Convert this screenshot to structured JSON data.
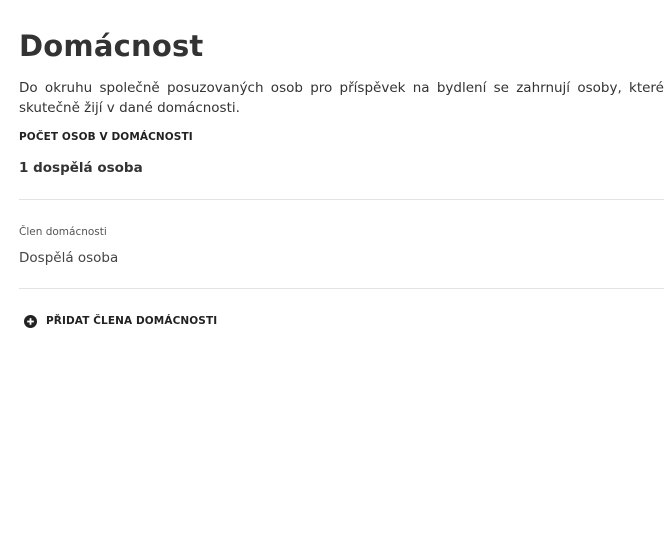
{
  "page": {
    "title": "Domácnost",
    "intro": "Do okruhu společně posuzovaných osob pro příspěvek na bydlení se zahrnují osoby, které skutečně žijí v dané domácnosti."
  },
  "household": {
    "count_label": "POČET OSOB V DOMÁCNOSTI",
    "count_value": "1 dospělá osoba"
  },
  "member": {
    "label": "Člen domácnosti",
    "value": "Dospělá osoba"
  },
  "actions": {
    "add_member_label": "PŘIDAT ČLENA DOMÁCNOSTI",
    "add_member_icon": "plus-circle-icon"
  },
  "colors": {
    "text": "#333333",
    "divider": "#e3e3e3"
  }
}
